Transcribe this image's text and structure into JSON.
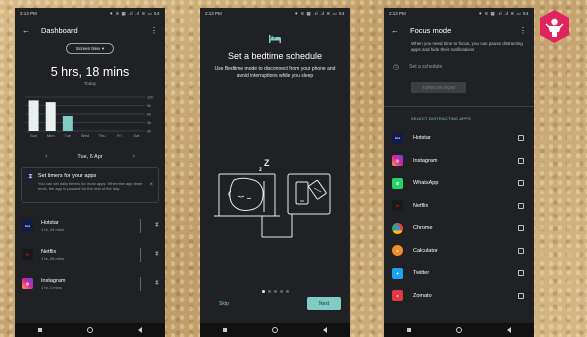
{
  "phones": {
    "dashboard": {
      "status": {
        "time": "2:13 PM",
        "icons": "⁕ ≋ ▦ .ıl .ıl ≋ ▭ 54"
      },
      "title": "Dashboard",
      "pill": {
        "label": "Screen time",
        "caret": "▾"
      },
      "total_time": "5 hrs, 18 mins",
      "period": "Today",
      "chart_data": {
        "type": "bar",
        "categories": [
          "Sun",
          "Mon",
          "Tue",
          "Wed",
          "Thu",
          "Fri",
          "Sat"
        ],
        "values": [
          10.8,
          10.2,
          5.3,
          0,
          0,
          0,
          0
        ],
        "yticks": [
          "12h",
          "9h",
          "6h",
          "3h",
          "0h"
        ],
        "ylim": [
          0,
          12
        ],
        "ylabel": "",
        "xlabel": "",
        "grid": true,
        "colors": {
          "bar": "#e8f0f0",
          "bar_selected": "#80cbc4",
          "grid": "#5f6368",
          "tick": "#9aa0a6"
        }
      },
      "date_nav": {
        "prev": "‹",
        "date": "Tue, 6 Apr",
        "next": "›"
      },
      "timer_card": {
        "title": "Set timers for your apps",
        "body": "You can set daily timers for most apps. When the app timer ends, the app is paused for the rest of the day.",
        "close": "×"
      },
      "apps": [
        {
          "name": "Hotstar",
          "time": "1 hr, 44 mins",
          "icon": "hotstar-icon",
          "color": "#0f1b4c",
          "glyph": "hot"
        },
        {
          "name": "Netflix",
          "time": "1 hr, 28 mins",
          "icon": "netflix-icon",
          "color": "#c6181f",
          "glyph": "N"
        },
        {
          "name": "Instagram",
          "time": "1 hr, 1 mins",
          "icon": "instagram-icon",
          "color": "#d6249f",
          "glyph": "◎"
        }
      ],
      "hourglass": "⧗"
    },
    "bedtime": {
      "status": {
        "time": "2:13 PM",
        "icons": "⁕ ≋ ▦ .ıl .ıl ≋ ▭ 54"
      },
      "bed_glyph": "🛏",
      "title": "Set a bedtime schedule",
      "body": "Use Bedtime mode to disconnect from your phone and avoid interruptions while you sleep",
      "zz": "Z",
      "zz_small": "z",
      "skip": "Skip",
      "next": "Next",
      "pages": 5,
      "active_page": 0
    },
    "focus": {
      "status": {
        "time": "2:13 PM",
        "icons": "⁕ ≋ ▦ .ıl .ıl ≋ ▭ 54"
      },
      "title": "Focus mode",
      "description": "When you need time to focus, you can pause distracting apps and hide their notifications",
      "schedule": "Set a schedule",
      "turn_on": "TURN ON NOW",
      "section_label": "SELECT DISTRACTING APPS",
      "apps": [
        {
          "name": "Hotstar",
          "color": "#0f1b4c",
          "glyph": "hot"
        },
        {
          "name": "Instagram",
          "color": "#d6249f",
          "glyph": "◎"
        },
        {
          "name": "WhatsApp",
          "color": "#25d366",
          "glyph": "✆"
        },
        {
          "name": "Netflix",
          "color": "#c6181f",
          "glyph": "N"
        },
        {
          "name": "Chrome",
          "color": "#e8eaed",
          "glyph": "◉"
        },
        {
          "name": "Calculator",
          "color": "#f28b2c",
          "glyph": "±"
        },
        {
          "name": "Twitter",
          "color": "#1da1f2",
          "glyph": "✦"
        },
        {
          "name": "Zomato",
          "color": "#e23744",
          "glyph": "z"
        }
      ]
    }
  },
  "colors": {
    "accent": "#80cbc4",
    "screen": "#202124",
    "logo": "#e0245e"
  }
}
